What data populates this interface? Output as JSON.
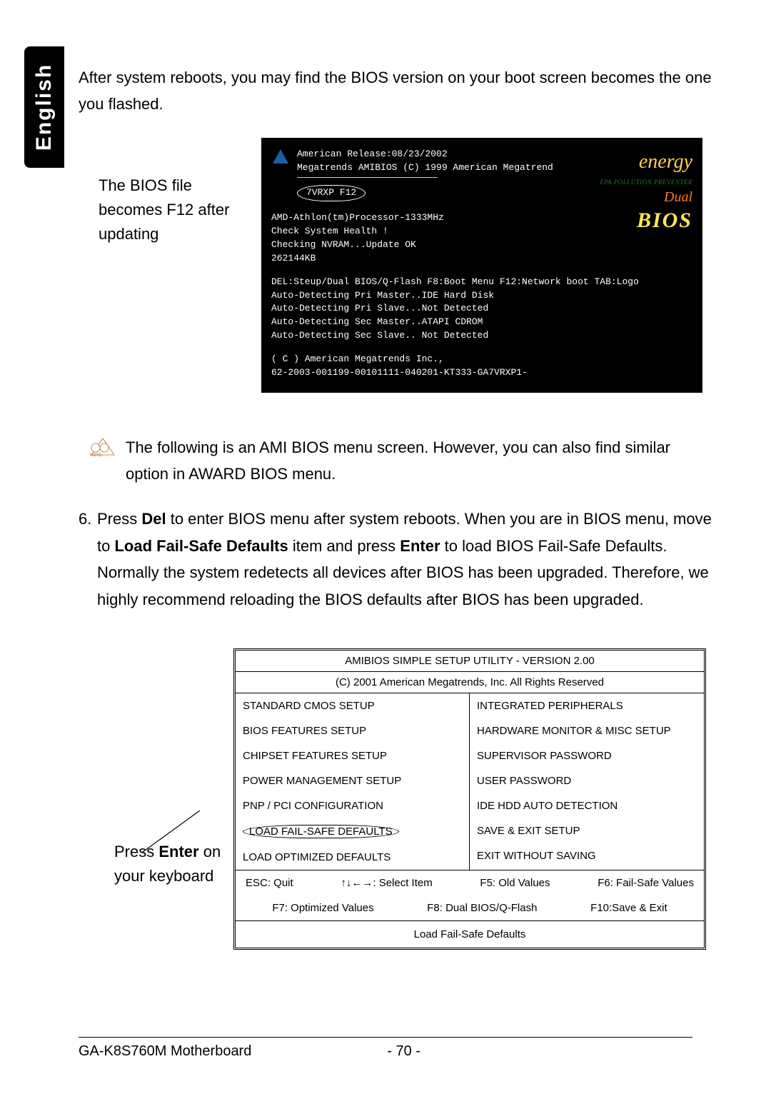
{
  "language_tab": "English",
  "intro": "After system reboots, you may find the BIOS version on your boot screen becomes the one you flashed.",
  "callout_label": "The BIOS file becomes F12 after updating",
  "boot": {
    "vendor_line1": "American     Release:08/23/2002",
    "vendor_line2": "Megatrends  AMIBIOS (C) 1999 American Megatrend",
    "version_box": "7VRXP F12",
    "cpu_line": "AMD-Athlon(tm)Processor-1333MHz",
    "health": "Check System Health !",
    "nvram": "Checking NVRAM...Update OK",
    "mem": "262144KB",
    "del_line": "DEL:Steup/Dual BIOS/Q-Flash F8:Boot Menu F12:Network boot TAB:Logo",
    "det1": "Auto-Detecting Pri Master..IDE Hard Disk",
    "det2": "Auto-Detecting Pri Slave...Not Detected",
    "det3": "Auto-Detecting Sec Master..ATAPI CDROM",
    "det4": "Auto-Detecting Sec Slave.. Not Detected",
    "copyright": "( C ) American Megatrends Inc.,",
    "serial": "62-2003-001199-00101111-040201-KT333-GA7VRXP1-",
    "logo": {
      "energy": "energy",
      "epa": "EPA POLLUTION PREVENTER",
      "dual": "Dual",
      "bios": "BIOS"
    }
  },
  "note_label": "NOTE",
  "note": "The following is an AMI BIOS menu screen. However, you can also find similar option in AWARD BIOS menu.",
  "step6_num": "6.",
  "step6_a": "Press ",
  "step6_del": "Del",
  "step6_b": " to enter BIOS menu after system reboots. When you are in BIOS menu, move to ",
  "step6_load": "Load Fail-Safe Defaults",
  "step6_c": " item and press ",
  "step6_enter": "Enter",
  "step6_d": " to load BIOS Fail-Safe Defaults. Normally the system redetects all devices after BIOS has been upgraded. Therefore, we highly recommend reloading the BIOS defaults after BIOS has been upgraded.",
  "enter_label_a": "Press ",
  "enter_label_b": "Enter",
  "enter_label_c": " on your keyboard",
  "ami": {
    "title1": "AMIBIOS SIMPLE SETUP UTILITY - VERSION 2.00",
    "title2": "(C) 2001 American Megatrends, Inc. All Rights Reserved",
    "left": [
      "STANDARD CMOS SETUP",
      "BIOS FEATURES SETUP",
      "CHIPSET FEATURES SETUP",
      "POWER MANAGEMENT SETUP",
      "PNP / PCI CONFIGURATION",
      "LOAD FAIL-SAFE DEFAULTS",
      "LOAD OPTIMIZED DEFAULTS"
    ],
    "right": [
      "INTEGRATED PERIPHERALS",
      "HARDWARE MONITOR & MISC SETUP",
      "SUPERVISOR PASSWORD",
      "USER PASSWORD",
      "IDE HDD AUTO DETECTION",
      "SAVE & EXIT SETUP",
      "EXIT WITHOUT SAVING"
    ],
    "keys1": {
      "esc": "ESC: Quit",
      "nav": "↑↓←→: Select Item",
      "f5": "F5: Old Values",
      "f6": "F6: Fail-Safe Values"
    },
    "keys2": {
      "f7": "F7: Optimized Values",
      "f8": "F8: Dual BIOS/Q-Flash",
      "f10": "F10:Save & Exit"
    },
    "footer": "Load Fail-Safe Defaults"
  },
  "page_footer": {
    "product": "GA-K8S760M Motherboard",
    "page": "- 70 -"
  }
}
